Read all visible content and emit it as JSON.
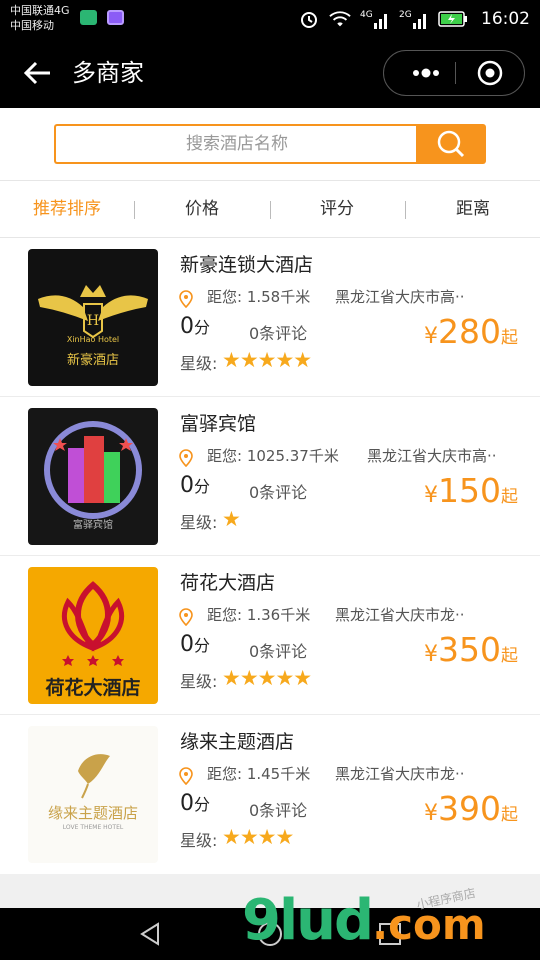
{
  "status_bar": {
    "carrier_line1": "中国联通4G",
    "carrier_line2": "中国移动",
    "net1": "4G",
    "net2": "2G",
    "time": "16:02"
  },
  "nav": {
    "title": "多商家"
  },
  "search": {
    "placeholder": "搜索酒店名称"
  },
  "sort_tabs": [
    "推荐排序",
    "价格",
    "评分",
    "距离"
  ],
  "hotels": [
    {
      "name": "新豪连锁大酒店",
      "distance": "距您: 1.58千米",
      "address": "黑龙江省大庆市高··",
      "score": "0",
      "score_unit": "分",
      "reviews": "0条评论",
      "currency": "¥",
      "price": "280",
      "price_suffix": "起",
      "star_label": "星级:",
      "stars": "★★★★★",
      "logo_text": "新豪酒店",
      "logo_sub": "XinHao  Hotel"
    },
    {
      "name": "富驿宾馆",
      "distance": "距您: 1025.37千米",
      "address": "黑龙江省大庆市高··",
      "score": "0",
      "score_unit": "分",
      "reviews": "0条评论",
      "currency": "¥",
      "price": "150",
      "price_suffix": "起",
      "star_label": "星级:",
      "stars": "★",
      "logo_text": "富驿宾馆",
      "logo_sub": ""
    },
    {
      "name": "荷花大酒店",
      "distance": "距您: 1.36千米",
      "address": "黑龙江省大庆市龙··",
      "score": "0",
      "score_unit": "分",
      "reviews": "0条评论",
      "currency": "¥",
      "price": "350",
      "price_suffix": "起",
      "star_label": "星级:",
      "stars": "★★★★★",
      "logo_text": "荷花大酒店",
      "logo_sub": ""
    },
    {
      "name": "缘来主题酒店",
      "distance": "距您: 1.45千米",
      "address": "黑龙江省大庆市龙··",
      "score": "0",
      "score_unit": "分",
      "reviews": "0条评论",
      "currency": "¥",
      "price": "390",
      "price_suffix": "起",
      "star_label": "星级:",
      "stars": "★★★★",
      "logo_text": "缘来主题酒店",
      "logo_sub": "LOVE THEME HOTEL"
    }
  ],
  "watermark": {
    "text": "9lud",
    "suffix": ".com",
    "cn": "小程序商店"
  },
  "colors": {
    "accent": "#f7941d",
    "star": "#f7a91d",
    "bar": "#000000"
  }
}
